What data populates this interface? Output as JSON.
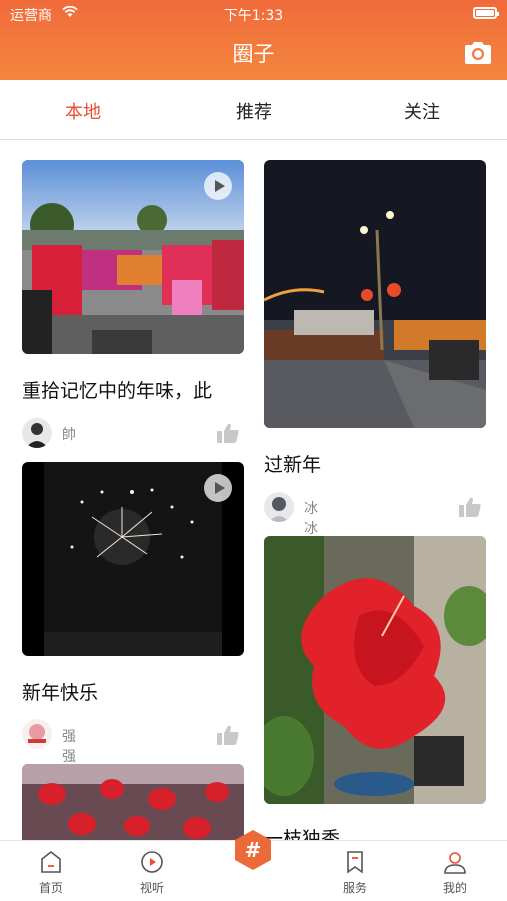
{
  "status": {
    "carrier": "运营商",
    "time": "下午1:33"
  },
  "header": {
    "title": "圈子"
  },
  "tabs": [
    {
      "label": "本地"
    },
    {
      "label": "推荐"
    },
    {
      "label": "关注"
    }
  ],
  "left_cards": [
    {
      "title": "重拾记忆中的年味，此",
      "user": "帥"
    },
    {
      "title": "新年快乐",
      "user": "强强"
    }
  ],
  "right_cards": [
    {
      "title": "过新年",
      "user": "冰冰"
    },
    {
      "title": "一枝独秀"
    }
  ],
  "bottom_nav": [
    {
      "label": "首页"
    },
    {
      "label": "视听"
    },
    {
      "label": "#"
    },
    {
      "label": "服务"
    },
    {
      "label": "我的"
    }
  ],
  "colors": {
    "accent": "#ea4e36",
    "header_start": "#f06a3a",
    "header_end": "#f3873f"
  }
}
